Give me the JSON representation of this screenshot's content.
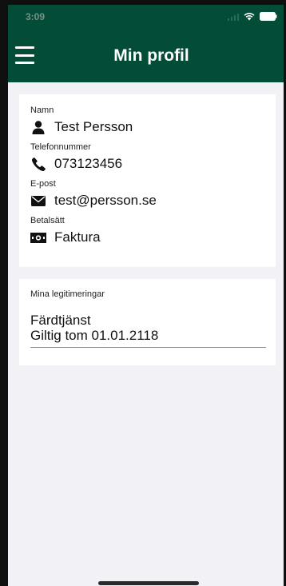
{
  "status_bar": {
    "time": "3:09"
  },
  "navbar": {
    "title": "Min profil"
  },
  "profile": {
    "name_label": "Namn",
    "name_value": "Test Persson",
    "phone_label": "Telefonnummer",
    "phone_value": "073123456",
    "email_label": "E-post",
    "email_value": "test@persson.se",
    "payment_label": "Betalsätt",
    "payment_value": "Faktura"
  },
  "credentials": {
    "title": "Mina legitimeringar",
    "items": [
      {
        "name": "Färdtjänst",
        "validity": "Giltig tom 01.01.2118"
      }
    ]
  },
  "colors": {
    "header_bg": "#034d38",
    "page_bg": "#f2f2f6",
    "card_bg": "#ffffff"
  },
  "icons": {
    "menu": "menu-icon",
    "name": "user-icon",
    "phone": "phone-icon",
    "email": "envelope-icon",
    "payment": "money-icon"
  }
}
